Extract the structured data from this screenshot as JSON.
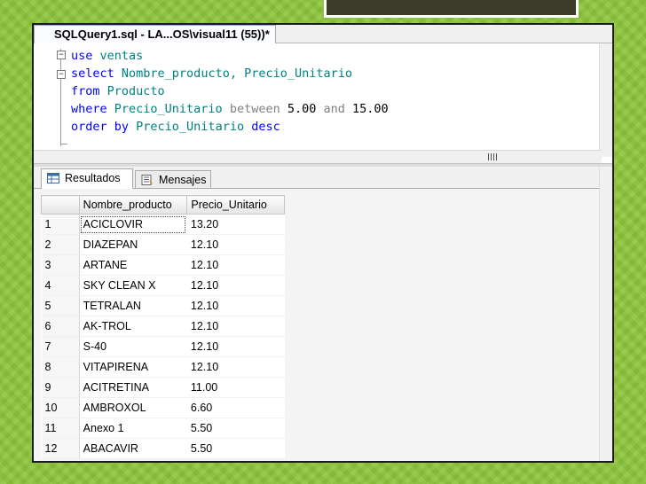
{
  "window": {
    "tab_title": "SQLQuery1.sql - LA...OS\\visual11 (55))*"
  },
  "editor": {
    "lines": [
      {
        "t1": "use",
        "t2": " ventas"
      },
      {
        "t1": "select",
        "t2": " Nombre_producto, Precio_Unitario"
      },
      {
        "t1": "from",
        "t2": " Producto"
      },
      {
        "t1": "where",
        "t2": " Precio_Unitario",
        "t3": " between",
        "t4": " 5.00",
        "t5": " and",
        "t6": " 15.00"
      },
      {
        "t1": "order by",
        "t2": " Precio_Unitario",
        "t3": " desc"
      }
    ],
    "collapse_symbol": "−"
  },
  "results": {
    "tabs": [
      {
        "label": "Resultados",
        "active": true,
        "icon": "grid-icon"
      },
      {
        "label": "Mensajes",
        "active": false,
        "icon": "messages-icon"
      }
    ],
    "columns": [
      "",
      "Nombre_producto",
      "Precio_Unitario"
    ],
    "rows": [
      {
        "n": "1",
        "name": "ACICLOVIR",
        "price": "13.20"
      },
      {
        "n": "2",
        "name": "DIAZEPAN",
        "price": "12.10"
      },
      {
        "n": "3",
        "name": "ARTANE",
        "price": "12.10"
      },
      {
        "n": "4",
        "name": "SKY CLEAN X",
        "price": "12.10"
      },
      {
        "n": "5",
        "name": "TETRALAN",
        "price": "12.10"
      },
      {
        "n": "6",
        "name": "AK-TROL",
        "price": "12.10"
      },
      {
        "n": "7",
        "name": "S-40",
        "price": "12.10"
      },
      {
        "n": "8",
        "name": "VITAPIRENA",
        "price": "12.10"
      },
      {
        "n": "9",
        "name": "ACITRETINA",
        "price": "11.00"
      },
      {
        "n": "10",
        "name": "AMBROXOL",
        "price": "6.60"
      },
      {
        "n": "11",
        "name": "Anexo 1",
        "price": "5.50"
      },
      {
        "n": "12",
        "name": "ABACAVIR",
        "price": "5.50"
      }
    ]
  },
  "colors": {
    "keyword": "#0000ff",
    "identifier": "#008080",
    "operator": "#808080",
    "background": "#8cc43a"
  }
}
